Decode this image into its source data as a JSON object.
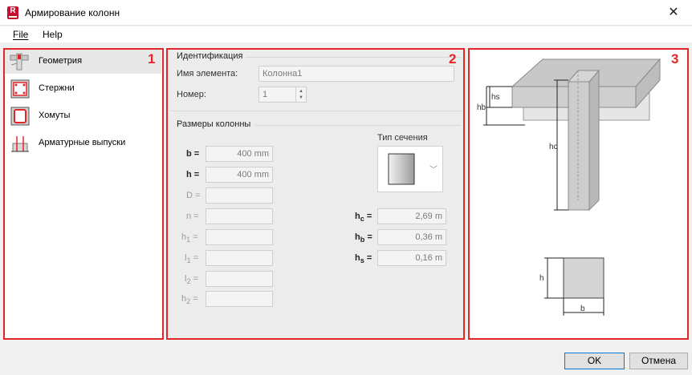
{
  "window": {
    "title": "Армирование колонн",
    "app_icon_letter": "R"
  },
  "menu": {
    "file": "File",
    "help": "Help"
  },
  "nav": {
    "items": [
      {
        "label": "Геометрия",
        "icon": "geometry-icon",
        "selected": true
      },
      {
        "label": "Стержни",
        "icon": "bars-icon"
      },
      {
        "label": "Хомуты",
        "icon": "stirrups-icon"
      },
      {
        "label": "Арматурные выпуски",
        "icon": "rebar-dowels-icon"
      }
    ]
  },
  "annotations": {
    "n1": "1",
    "n2": "2",
    "n3": "3"
  },
  "identification": {
    "title": "Идентификация",
    "name_label": "Имя элемента:",
    "name_value": "Колонна1",
    "number_label": "Номер:",
    "number_value": "1"
  },
  "dimensions": {
    "title": "Размеры колонны",
    "section_type_label": "Тип сечения",
    "b": {
      "label": "b =",
      "value": "400 mm"
    },
    "h": {
      "label": "h =",
      "value": "400 mm"
    },
    "D": {
      "label": "D =",
      "value": ""
    },
    "n": {
      "label": "n =",
      "value": ""
    },
    "h1": {
      "label_main": "h",
      "label_sub": "1",
      "label_eq": " =",
      "value": ""
    },
    "l1": {
      "label_main": "l",
      "label_sub": "1",
      "label_eq": " =",
      "value": ""
    },
    "l2": {
      "label_main": "l",
      "label_sub": "2",
      "label_eq": " =",
      "value": ""
    },
    "h2": {
      "label_main": "h",
      "label_sub": "2",
      "label_eq": " =",
      "value": ""
    },
    "hc": {
      "label_main": "h",
      "label_sub": "c",
      "label_eq": " =",
      "value": "2,69 m"
    },
    "hb": {
      "label_main": "h",
      "label_sub": "b",
      "label_eq": " =",
      "value": "0,36 m"
    },
    "hs": {
      "label_main": "h",
      "label_sub": "s",
      "label_eq": " =",
      "value": "0,16 m"
    }
  },
  "diagram": {
    "hs": "hs",
    "hb": "hb",
    "hc": "hc",
    "h": "h",
    "b": "b"
  },
  "buttons": {
    "ok": "OK",
    "cancel": "Отмена"
  }
}
